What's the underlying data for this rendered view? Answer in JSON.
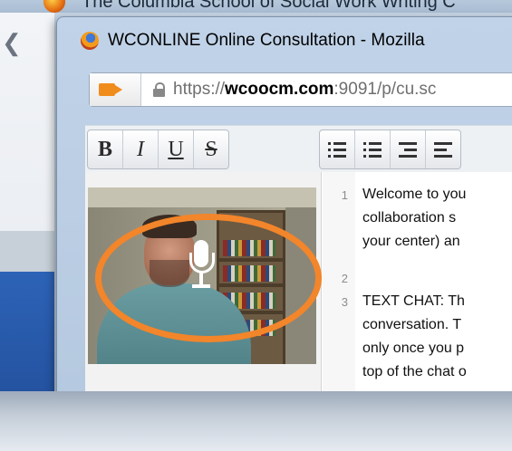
{
  "background_window": {
    "title": "The Columbia School of Social Work Writing C",
    "back_icon": "back-arrow-icon"
  },
  "window": {
    "title": "WCONLINE Online Consultation - Mozilla",
    "icon": "firefox-icon"
  },
  "url_bar": {
    "prefix": "https://",
    "domain": "wcoocm.com",
    "suffix": ":9091/p/cu.sc",
    "icons": [
      "camera-icon",
      "lock-icon"
    ],
    "camera_color": "#f08c1c"
  },
  "toolbar": {
    "bold": "B",
    "italic": "I",
    "underline": "U",
    "strike": "S",
    "icons": [
      "ordered-list-icon",
      "unordered-list-icon",
      "indent-icon",
      "outdent-icon"
    ]
  },
  "video": {
    "icon": "microphone-icon",
    "highlight_color": "#f3852a"
  },
  "editor": {
    "line_numbers": [
      "1",
      "2",
      "3"
    ],
    "lines": [
      "Welcome to you",
      "collaboration s",
      "your center) an",
      "TEXT CHAT: Th",
      "conversation. T",
      "only once you p",
      "top of the chat o"
    ]
  }
}
